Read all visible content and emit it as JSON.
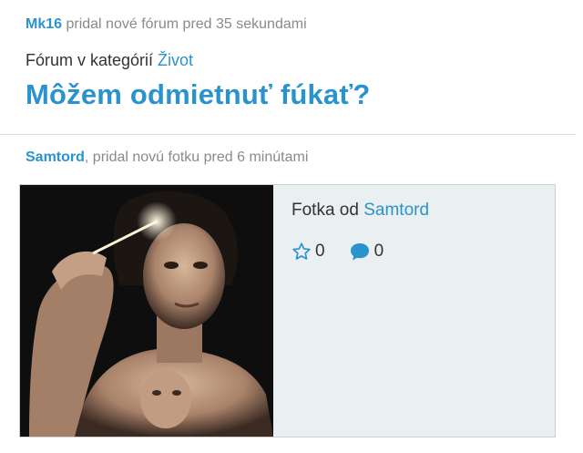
{
  "activities": [
    {
      "user": "Mk16",
      "action": " pridal nové fórum pred 35 sekundami",
      "category_prefix": "Fórum v kategórií ",
      "category": "Život",
      "title": "Môžem odmietnuť fúkať?"
    },
    {
      "user": "Samtord",
      "action": ", pridal novú fotku pred 6 minútami",
      "photo_by_prefix": "Fotka od ",
      "photo_by_user": "Samtord",
      "likes": "0",
      "comments": "0"
    }
  ],
  "icons": {
    "like": "star-outline-icon",
    "comment": "speech-bubble-icon"
  },
  "colors": {
    "link": "#2a93cc",
    "card_bg": "#eaeff1",
    "muted": "#8a8a8a"
  }
}
